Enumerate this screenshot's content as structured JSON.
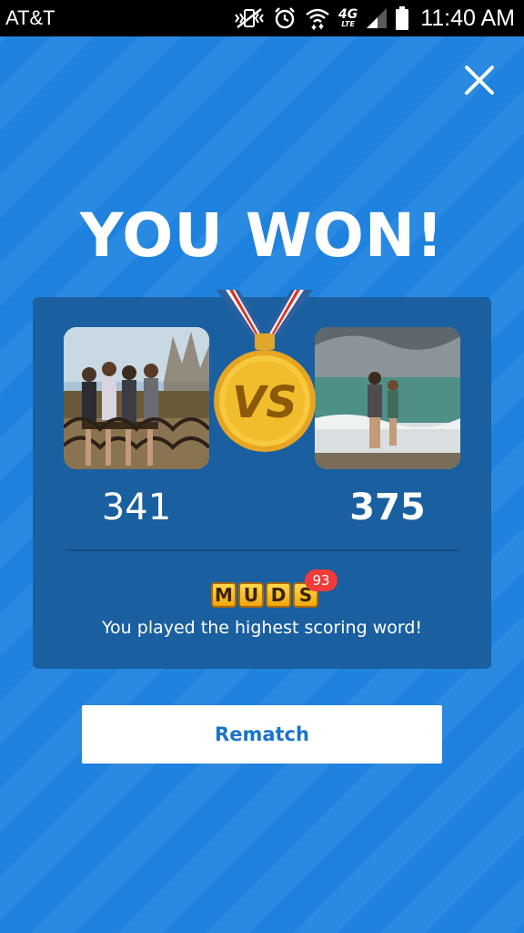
{
  "status_bar": {
    "carrier": "AT&T",
    "time": "11:40 AM",
    "network_badge": "4G",
    "network_sub": "LTE",
    "icons": [
      "vibrate-off-icon",
      "alarm-icon",
      "wifi-icon",
      "network-4g-lte-icon",
      "signal-icon",
      "battery-icon"
    ]
  },
  "header": {
    "close_icon": "close-icon"
  },
  "result": {
    "headline": "YOU WON!",
    "vs_label": "VS",
    "player": {
      "score": "341",
      "avatar": "photo of four people posing on a railing"
    },
    "opponent": {
      "score": "375",
      "avatar": "photo of two people in the ocean"
    },
    "highlight": {
      "word_letters": [
        "M",
        "U",
        "D",
        "S"
      ],
      "word_score": "93",
      "text": "You played the highest scoring word!"
    }
  },
  "actions": {
    "rematch_label": "Rematch"
  },
  "colors": {
    "background": "#1e82de",
    "card": "#1a5f9f",
    "button_text": "#1a74c9",
    "badge": "#f03b3b",
    "tile": "#f5b820",
    "medal": "#f2c230"
  }
}
